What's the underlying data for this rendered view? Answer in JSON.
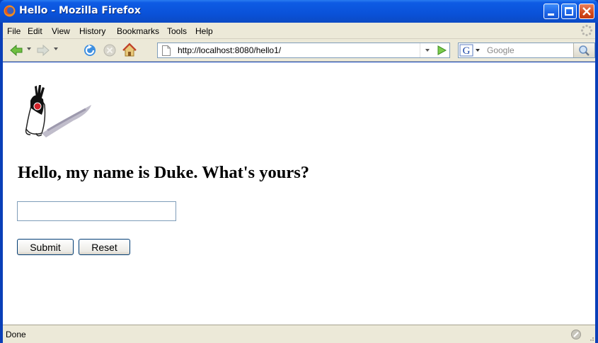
{
  "window": {
    "title": "Hello - Mozilla Firefox",
    "colors": {
      "titlebar": "#0a52d9",
      "chrome": "#ece9d8",
      "close": "#d24a1c"
    }
  },
  "menu": {
    "items": [
      "File",
      "Edit",
      "View",
      "History",
      "Bookmarks",
      "Tools",
      "Help"
    ]
  },
  "toolbar": {
    "back_icon": "back-arrow-icon",
    "forward_icon": "forward-arrow-icon",
    "reload_icon": "reload-icon",
    "stop_icon": "stop-icon",
    "home_icon": "home-icon",
    "url": "http://localhost:8080/hello1/",
    "go_icon": "go-arrow-icon",
    "search_engine": "G",
    "search_placeholder": "Google",
    "search_icon": "magnifier-icon"
  },
  "page": {
    "heading": "Hello, my name is Duke. What's yours?",
    "name_input_value": "",
    "submit_label": "Submit",
    "reset_label": "Reset",
    "mascot": "duke-mascot-image"
  },
  "status": {
    "text": "Done"
  }
}
